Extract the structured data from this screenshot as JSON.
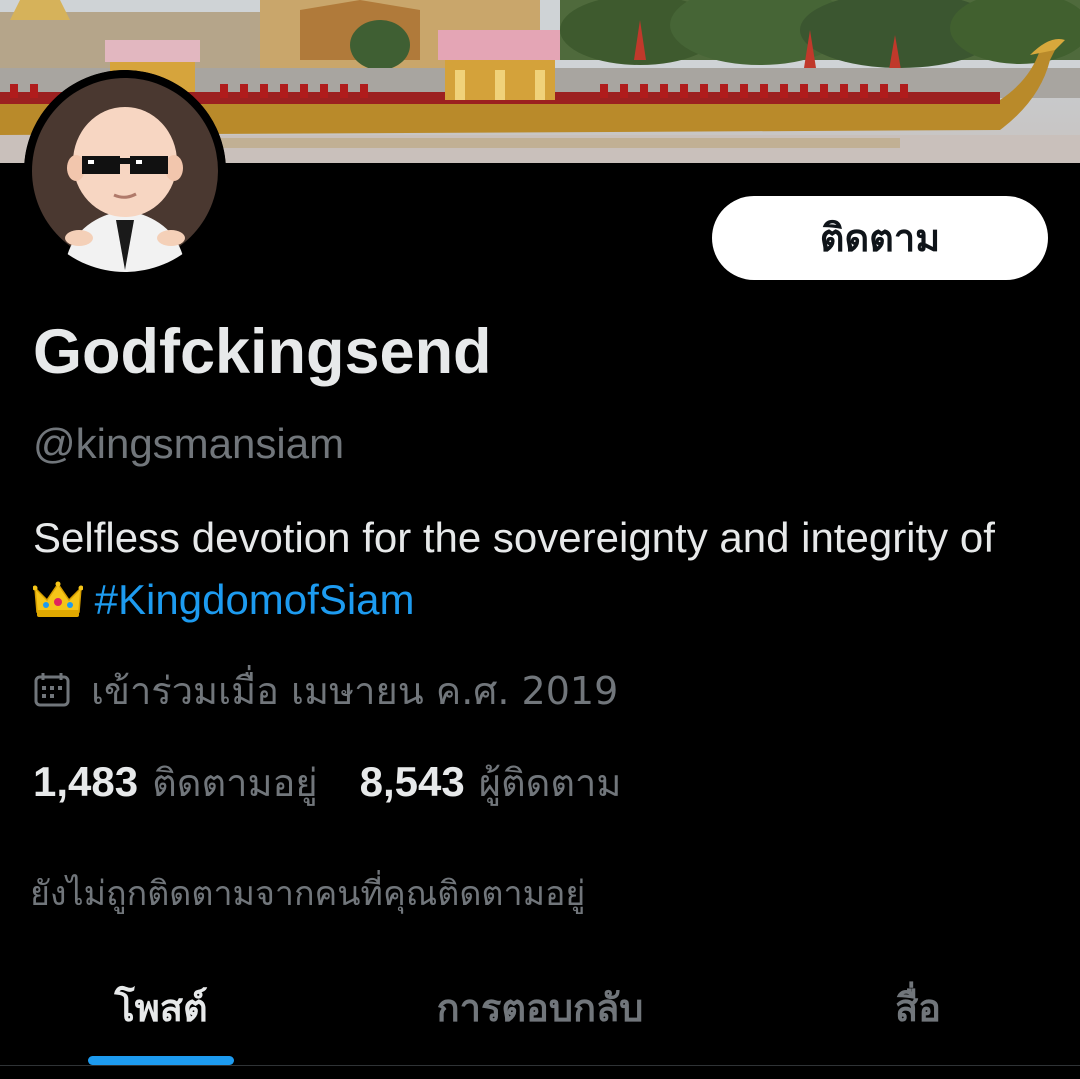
{
  "profile": {
    "display_name": "Godfckingsend",
    "handle": "@kingsmansiam",
    "bio_text": "Selfless devotion for the sovereignty and integrity of",
    "bio_emoji": "crown-emoji",
    "bio_hashtag": "#KingdomofSiam",
    "joined": "เข้าร่วมเมื่อ เมษายน ค.ศ. 2019",
    "joined_icon": "calendar-icon",
    "avatar_icon": "boss-baby-avatar"
  },
  "actions": {
    "follow_label": "ติดตาม"
  },
  "stats": {
    "following_count": "1,483",
    "following_label": "ติดตามอยู่",
    "followers_count": "8,543",
    "followers_label": "ผู้ติดตาม"
  },
  "not_followed_text": "ยังไม่ถูกติดตามจากคนที่คุณติดตามอยู่",
  "tabs": [
    {
      "label": "โพสต์",
      "active": true
    },
    {
      "label": "การตอบกลับ",
      "active": false
    },
    {
      "label": "สื่อ",
      "active": false
    }
  ],
  "colors": {
    "background": "#000000",
    "primary_text": "#e7e9ea",
    "secondary_text": "#71767b",
    "accent": "#1d9bf0",
    "button_bg": "#ffffff",
    "button_text": "#0f1419"
  }
}
